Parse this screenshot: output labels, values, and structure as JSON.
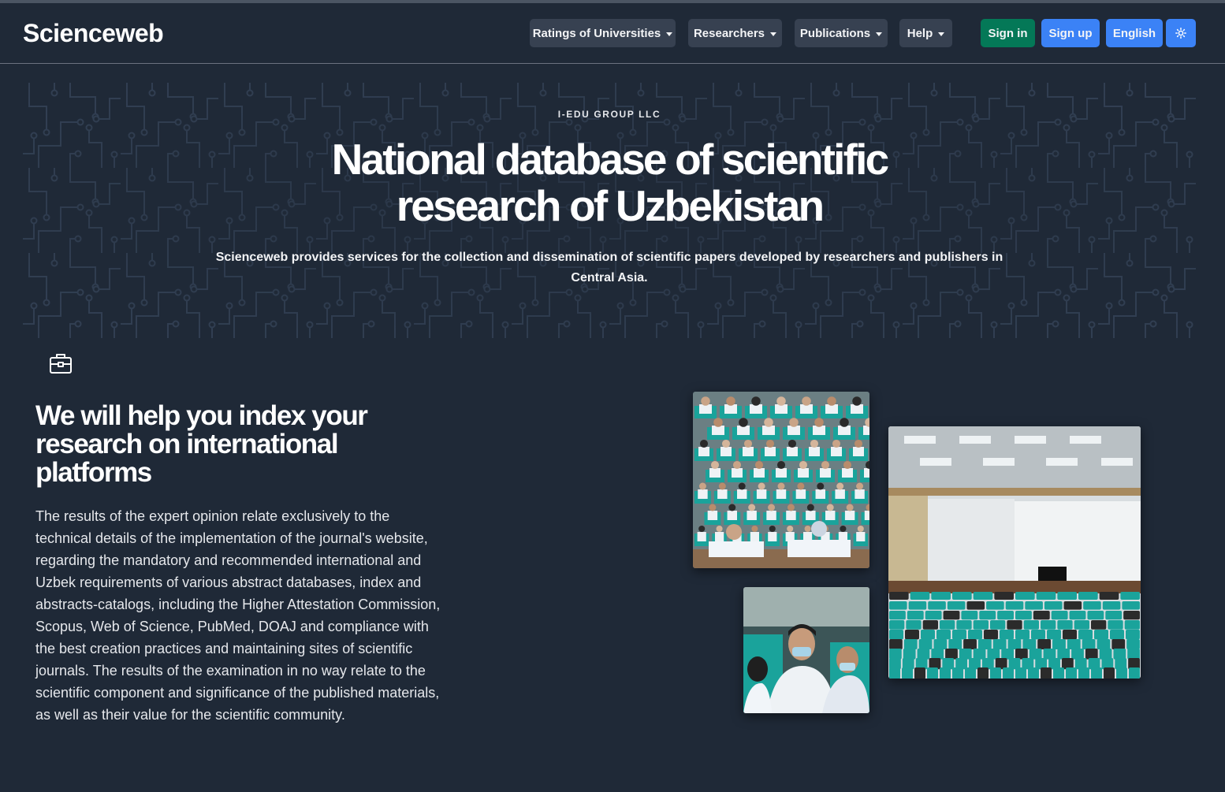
{
  "header": {
    "brand": "Scienceweb",
    "nav": {
      "ratings": "Ratings of Universities",
      "researchers": "Researchers",
      "publications": "Publications",
      "help": "Help"
    },
    "sign_in": "Sign in",
    "sign_up": "Sign up",
    "language": "English",
    "theme_icon": "sun-icon"
  },
  "hero": {
    "eyebrow": "I-EDU GROUP LLC",
    "title": "National database of scientific research of Uzbekistan",
    "subtitle": "Scienceweb provides services for the collection and dissemination of scientific papers developed by researchers and publishers in Central Asia."
  },
  "feature": {
    "icon": "briefcase-icon",
    "title": "We will help you index your research on international platforms",
    "text": "The results of the expert opinion relate exclusively to the technical details of the implementation of the journal's website, regarding the mandatory and recommended international and Uzbek requirements of various abstract databases, index and abstracts-catalogs, including the Higher Attestation Commission, Scopus, Web of Science, PubMed, DOAJ and compliance with the best creation practices and maintaining sites of scientific journals. The results of the examination in no way relate to the scientific component and significance of the published materials, as well as their value for the scientific community."
  },
  "colors": {
    "background": "#1f2937",
    "nav_button": "#374151",
    "sign_in": "#047857",
    "sign_up": "#2563eb",
    "seat_teal": "#1aa39b"
  }
}
